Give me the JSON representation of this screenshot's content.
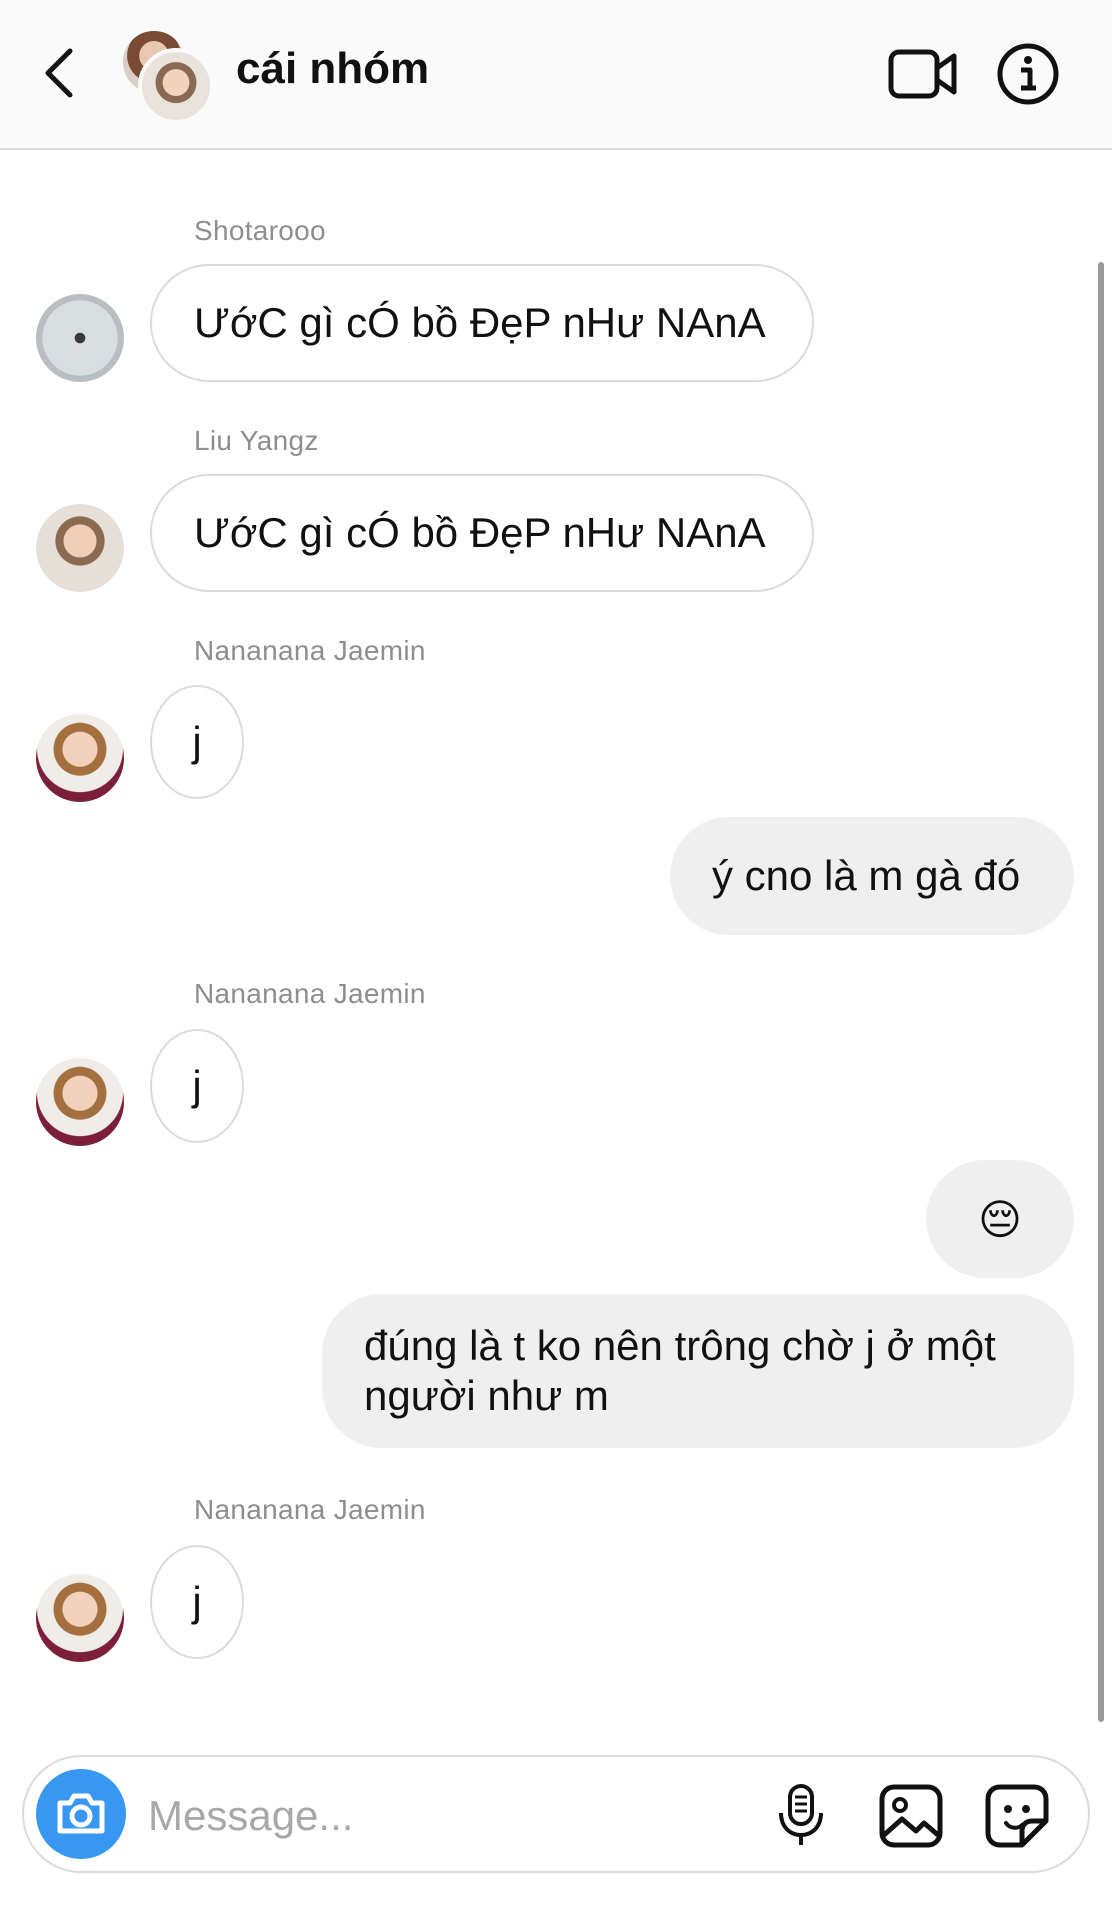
{
  "header": {
    "title": "cái nhóm",
    "icons": [
      "back-icon",
      "video-call-icon",
      "info-icon"
    ]
  },
  "messages": [
    {
      "type": "incoming",
      "sender": "Shotarooo",
      "text": "ƯớC gì cÓ bồ ĐẹP nHư NAnA"
    },
    {
      "type": "incoming",
      "sender": "Liu Yangz",
      "text": "ƯớC gì cÓ bồ ĐẹP nHư NAnA"
    },
    {
      "type": "incoming",
      "sender": "Nananana Jaemin",
      "text": "j"
    },
    {
      "type": "outgoing",
      "text": "ý cno là m gà đó"
    },
    {
      "type": "incoming",
      "sender": "Nananana Jaemin",
      "text": "j"
    },
    {
      "type": "outgoing",
      "text": "😔"
    },
    {
      "type": "outgoing",
      "text": "đúng là t ko nên trông chờ j ở một người như m"
    },
    {
      "type": "incoming",
      "sender": "Nananana Jaemin",
      "text": "j"
    }
  ],
  "composer": {
    "placeholder": "Message...",
    "icons": [
      "camera-icon",
      "microphone-icon",
      "gallery-icon",
      "sticker-icon"
    ]
  },
  "colors": {
    "accent": "#3897f0",
    "outgoing_bubble": "#efefef",
    "incoming_border": "#dbdbdb",
    "sender_name": "#8e8e8e"
  }
}
